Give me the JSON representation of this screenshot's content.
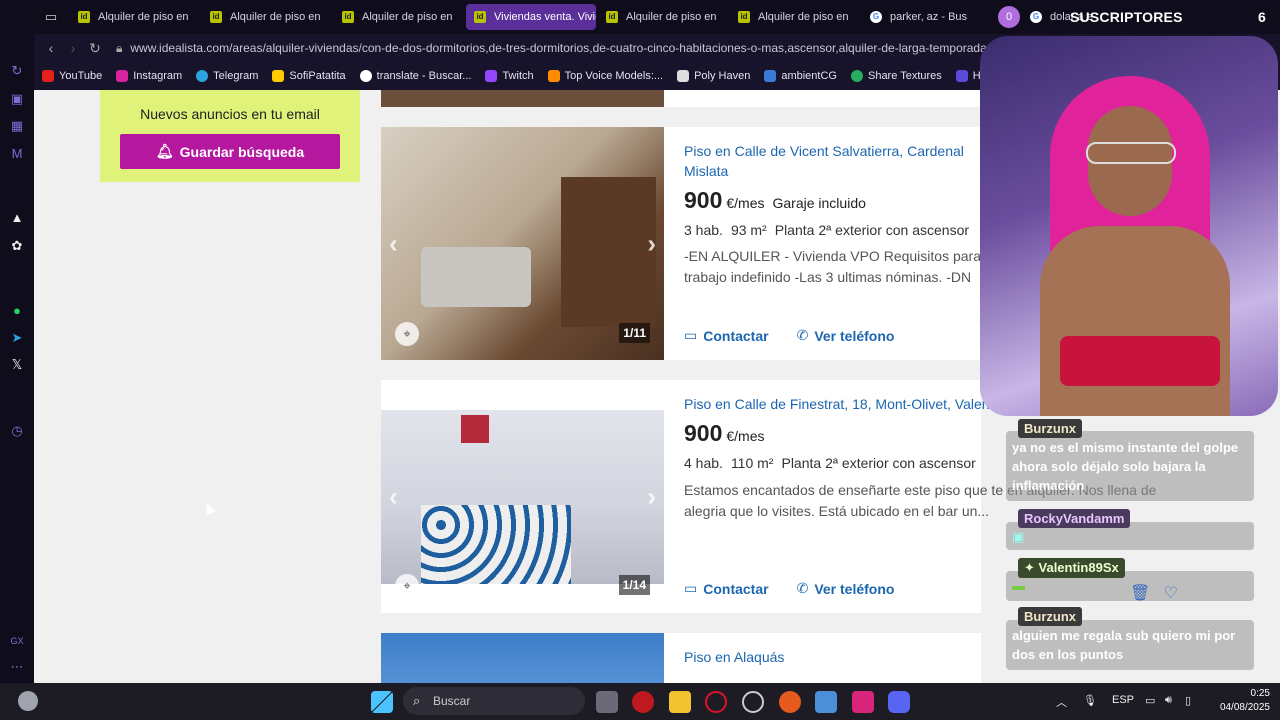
{
  "browser": {
    "tabs": [
      {
        "label": "Alquiler de piso en"
      },
      {
        "label": "Alquiler de piso en"
      },
      {
        "label": "Alquiler de piso en"
      },
      {
        "label": "Viviendas venta. Vivienda"
      },
      {
        "label": "Alquiler de piso en"
      },
      {
        "label": "Alquiler de piso en"
      },
      {
        "label": "parker, az - Bus"
      },
      {
        "label": "dolar a e"
      }
    ],
    "tab_badge": "0",
    "url": "www.idealista.com/areas/alquiler-viviendas/con-de-dos-dormitorios,de-tres-dormitorios,de-cuatro-cinco-habitaciones-o-mas,ascensor,alquiler-de-larga-temporada",
    "bookmarks": [
      {
        "label": "YouTube",
        "color": "#e62117"
      },
      {
        "label": "Instagram",
        "color": "#d6249f"
      },
      {
        "label": "Telegram",
        "color": "#2aa3df"
      },
      {
        "label": "SofiPatatita",
        "color": "#ffcc00"
      },
      {
        "label": "translate - Buscar...",
        "color": "#ffffff"
      },
      {
        "label": "Twitch",
        "color": "#9146ff"
      },
      {
        "label": "Top Voice Models:...",
        "color": "#ff8c00"
      },
      {
        "label": "Poly Haven",
        "color": "#dddddd"
      },
      {
        "label": "ambientCG",
        "color": "#3a7bd5"
      },
      {
        "label": "Share Textures",
        "color": "#27ae60"
      },
      {
        "label": "Har",
        "color": "#5b4bd8"
      }
    ]
  },
  "overlay": {
    "subs_label": "SUSCRIPTORES",
    "subs_count": "6"
  },
  "page": {
    "promo_title": "Nuevos anuncios en tu email",
    "promo_button": "Guardar búsqueda",
    "listings": [
      {
        "title": "Piso en Calle de Vicent Salvatierra, Cardenal Mislata",
        "price": "900",
        "price_unit": "€/mes",
        "price_extra": "Garaje incluido",
        "rooms": "3 hab.",
        "area": "93 m²",
        "floor": "Planta 2ª exterior con ascensor",
        "description": "-EN ALQUILER - Vivienda VPO Requisitos para trabajo indefinido -Las 3 ultimas nóminas. -DN",
        "photo_count": "1/11",
        "contact": "Contactar",
        "phone": "Ver teléfono"
      },
      {
        "title": "Piso en Calle de Finestrat, 18, Mont-Olivet, Valen",
        "price": "900",
        "price_unit": "€/mes",
        "price_extra": "",
        "rooms": "4 hab.",
        "area": "110 m²",
        "floor": "Planta 2ª exterior con ascensor",
        "description": "Estamos encantados de enseñarte este piso que te en alquiler. Nos llena de alegria que lo visites. Está ubicado en el bar un...",
        "photo_count": "1/14",
        "contact": "Contactar",
        "phone": "Ver teléfono"
      },
      {
        "title": "Piso en Alaquás"
      }
    ]
  },
  "chat": [
    {
      "user": "Burzunx",
      "text": "ya no es el mismo instante del golpe ahora solo déjalo solo bajara la inflamación"
    },
    {
      "user": "RockyVandamm",
      "text": ""
    },
    {
      "user": "Valentin89Sx",
      "text": ""
    },
    {
      "user": "Burzunx",
      "text": "alguien me regala sub quiero mi por dos en los puntos"
    }
  ],
  "taskbar": {
    "search_placeholder": "Buscar",
    "lang": "ESP",
    "time": "0:25",
    "date": "04/08/2025"
  }
}
